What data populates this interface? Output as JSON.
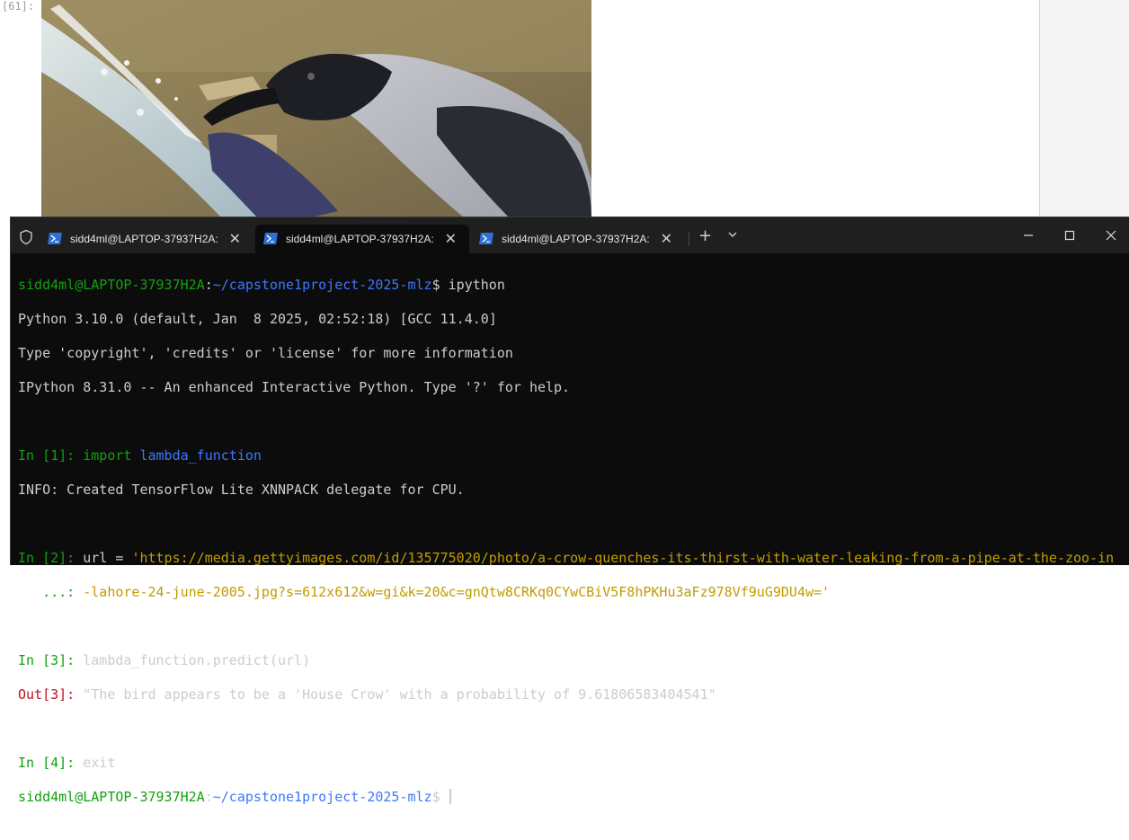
{
  "notebook": {
    "cell_prompt": "[61]:"
  },
  "image": {
    "description_icon": "crow-drinking-from-pipe-photo"
  },
  "terminal": {
    "tabs": [
      {
        "label": "sidd4ml@LAPTOP-37937H2A:",
        "active": false
      },
      {
        "label": "sidd4ml@LAPTOP-37937H2A:",
        "active": true
      },
      {
        "label": "sidd4ml@LAPTOP-37937H2A:",
        "active": false
      }
    ],
    "new_tab_label": "+",
    "lines": {
      "l1_user": "sidd4ml@LAPTOP-37937H2A",
      "l1_colon": ":",
      "l1_path": "~/capstone1project-2025-mlz",
      "l1_cmd": "$ ipython",
      "l2": "Python 3.10.0 (default, Jan  8 2025, 02:52:18) [GCC 11.4.0]",
      "l3": "Type 'copyright', 'credits' or 'license' for more information",
      "l4": "IPython 8.31.0 -- An enhanced Interactive Python. Type '?' for help.",
      "in1_prompt": "In [1]: ",
      "in1_kw": "import",
      "in1_mod": "lambda_function",
      "info": "INFO: Created TensorFlow Lite XNNPACK delegate for CPU.",
      "in2_prompt": "In [2]: ",
      "in2_code": "url = ",
      "in2_str1": "'https://media.gettyimages.com/id/135775020/photo/a-crow-quenches-its-thirst-with-water-leaking-from-a-pipe-at-the-zoo-in",
      "cont_prompt": "   ...: ",
      "in2_str2": "-lahore-24-june-2005.jpg?s=612x612&w=gi&k=20&c=gnQtw8CRKq0CYwCBiV5F8hPKHu3aFz978Vf9uG9DU4w='",
      "in3_prompt": "In [3]: ",
      "in3_code": "lambda_function.predict(url)",
      "out3_prompt": "Out[3]: ",
      "out3_value": "\"The bird appears to be a 'House Crow' with a probability of 9.61806583404541\"",
      "in4_prompt": "In [4]: ",
      "in4_code": "exit",
      "last_user": "sidd4ml@LAPTOP-37937H2A",
      "last_colon": ":",
      "last_path": "~/capstone1project-2025-mlz",
      "last_dollar": "$ "
    }
  },
  "colors": {
    "terminal_bg": "#0c0c0c",
    "titlebar_bg": "#1f1f1f",
    "green": "#13a10e",
    "blue": "#3b78ff",
    "yellow": "#c19c00",
    "red": "#c50f1f"
  }
}
